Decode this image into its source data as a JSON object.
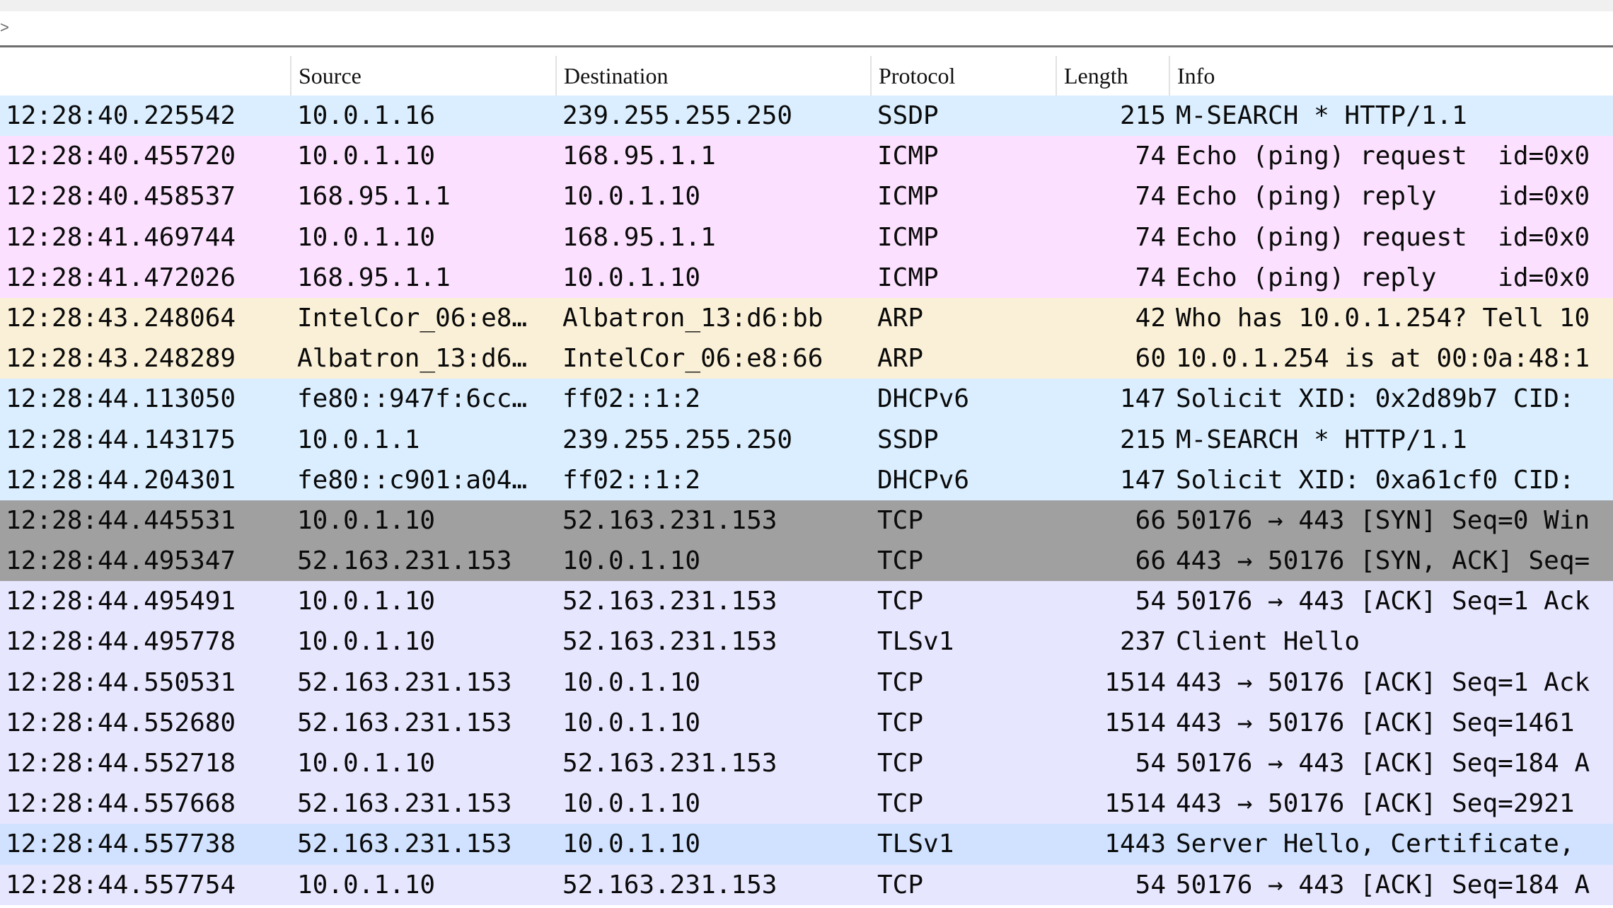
{
  "filter": {
    "caret": ">"
  },
  "columns": {
    "source": "Source",
    "destination": "Destination",
    "protocol": "Protocol",
    "length": "Length",
    "info": "Info"
  },
  "colors": {
    "ssdp": "#daeeff",
    "icmp": "#fce0ff",
    "arp": "#faf0d7",
    "tcp_syn": "#a0a0a0",
    "tcp": "#e7e6ff",
    "tls": "#d0e2ff"
  },
  "packets": [
    {
      "time": "12:28:40.225542",
      "source": "10.0.1.16",
      "destination": "239.255.255.250",
      "protocol": "SSDP",
      "length": "215",
      "info": "M-SEARCH * HTTP/1.1",
      "color": "ssdp"
    },
    {
      "time": "12:28:40.455720",
      "source": "10.0.1.10",
      "destination": "168.95.1.1",
      "protocol": "ICMP",
      "length": "74",
      "info": "Echo (ping) request  id=0x0",
      "color": "icmp"
    },
    {
      "time": "12:28:40.458537",
      "source": "168.95.1.1",
      "destination": "10.0.1.10",
      "protocol": "ICMP",
      "length": "74",
      "info": "Echo (ping) reply    id=0x0",
      "color": "icmp"
    },
    {
      "time": "12:28:41.469744",
      "source": "10.0.1.10",
      "destination": "168.95.1.1",
      "protocol": "ICMP",
      "length": "74",
      "info": "Echo (ping) request  id=0x0",
      "color": "icmp"
    },
    {
      "time": "12:28:41.472026",
      "source": "168.95.1.1",
      "destination": "10.0.1.10",
      "protocol": "ICMP",
      "length": "74",
      "info": "Echo (ping) reply    id=0x0",
      "color": "icmp"
    },
    {
      "time": "12:28:43.248064",
      "source": "IntelCor_06:e8…",
      "destination": "Albatron_13:d6:bb",
      "protocol": "ARP",
      "length": "42",
      "info": "Who has 10.0.1.254? Tell 10",
      "color": "arp"
    },
    {
      "time": "12:28:43.248289",
      "source": "Albatron_13:d6…",
      "destination": "IntelCor_06:e8:66",
      "protocol": "ARP",
      "length": "60",
      "info": "10.0.1.254 is at 00:0a:48:1",
      "color": "arp"
    },
    {
      "time": "12:28:44.113050",
      "source": "fe80::947f:6cc…",
      "destination": "ff02::1:2",
      "protocol": "DHCPv6",
      "length": "147",
      "info": "Solicit XID: 0x2d89b7 CID:",
      "color": "ssdp"
    },
    {
      "time": "12:28:44.143175",
      "source": "10.0.1.1",
      "destination": "239.255.255.250",
      "protocol": "SSDP",
      "length": "215",
      "info": "M-SEARCH * HTTP/1.1",
      "color": "ssdp"
    },
    {
      "time": "12:28:44.204301",
      "source": "fe80::c901:a04…",
      "destination": "ff02::1:2",
      "protocol": "DHCPv6",
      "length": "147",
      "info": "Solicit XID: 0xa61cf0 CID:",
      "color": "ssdp"
    },
    {
      "time": "12:28:44.445531",
      "source": "10.0.1.10",
      "destination": "52.163.231.153",
      "protocol": "TCP",
      "length": "66",
      "info": "50176 → 443 [SYN] Seq=0 Win",
      "color": "tcp_syn"
    },
    {
      "time": "12:28:44.495347",
      "source": "52.163.231.153",
      "destination": "10.0.1.10",
      "protocol": "TCP",
      "length": "66",
      "info": "443 → 50176 [SYN, ACK] Seq=",
      "color": "tcp_syn"
    },
    {
      "time": "12:28:44.495491",
      "source": "10.0.1.10",
      "destination": "52.163.231.153",
      "protocol": "TCP",
      "length": "54",
      "info": "50176 → 443 [ACK] Seq=1 Ack",
      "color": "tcp"
    },
    {
      "time": "12:28:44.495778",
      "source": "10.0.1.10",
      "destination": "52.163.231.153",
      "protocol": "TLSv1",
      "length": "237",
      "info": "Client Hello",
      "color": "tcp"
    },
    {
      "time": "12:28:44.550531",
      "source": "52.163.231.153",
      "destination": "10.0.1.10",
      "protocol": "TCP",
      "length": "1514",
      "info": "443 → 50176 [ACK] Seq=1 Ack",
      "color": "tcp"
    },
    {
      "time": "12:28:44.552680",
      "source": "52.163.231.153",
      "destination": "10.0.1.10",
      "protocol": "TCP",
      "length": "1514",
      "info": "443 → 50176 [ACK] Seq=1461",
      "color": "tcp"
    },
    {
      "time": "12:28:44.552718",
      "source": "10.0.1.10",
      "destination": "52.163.231.153",
      "protocol": "TCP",
      "length": "54",
      "info": "50176 → 443 [ACK] Seq=184 A",
      "color": "tcp"
    },
    {
      "time": "12:28:44.557668",
      "source": "52.163.231.153",
      "destination": "10.0.1.10",
      "protocol": "TCP",
      "length": "1514",
      "info": "443 → 50176 [ACK] Seq=2921",
      "color": "tcp"
    },
    {
      "time": "12:28:44.557738",
      "source": "52.163.231.153",
      "destination": "10.0.1.10",
      "protocol": "TLSv1",
      "length": "1443",
      "info": "Server Hello, Certificate,",
      "color": "tls"
    },
    {
      "time": "12:28:44.557754",
      "source": "10.0.1.10",
      "destination": "52.163.231.153",
      "protocol": "TCP",
      "length": "54",
      "info": "50176 → 443 [ACK] Seq=184 A",
      "color": "tcp"
    }
  ]
}
